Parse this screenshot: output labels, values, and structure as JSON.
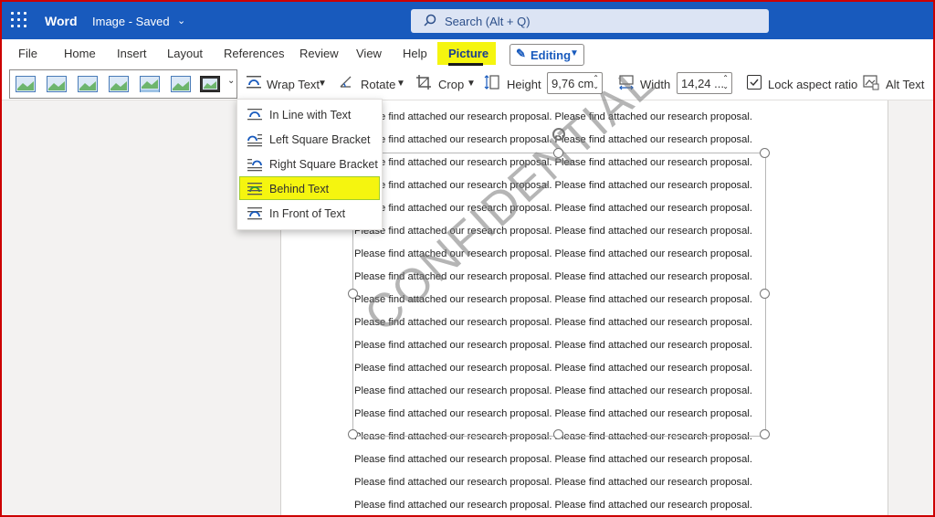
{
  "titlebar": {
    "app_name": "Word",
    "doc_name": "Image - Saved",
    "search_placeholder": "Search (Alt + Q)",
    "background_color": "#185abd"
  },
  "menu": {
    "items": [
      "File",
      "Home",
      "Insert",
      "Layout",
      "References",
      "Review",
      "View",
      "Help",
      "Picture"
    ],
    "active": "Picture",
    "editing_label": "Editing",
    "highlight_color": "#f5f50f"
  },
  "ribbon": {
    "wrap_text": "Wrap Text",
    "rotate": "Rotate",
    "crop": "Crop",
    "height_label": "Height",
    "height_value": "9,76 cm",
    "width_label": "Width",
    "width_value": "14,24 ...",
    "lock_aspect": "Lock aspect ratio",
    "lock_checked": true,
    "alt_text": "Alt Text"
  },
  "wrap_menu": {
    "items": [
      {
        "label": "In Line with Text",
        "icon": "inline-wrap-icon"
      },
      {
        "label": "Left Square Bracket",
        "icon": "left-square-wrap-icon"
      },
      {
        "label": "Right Square Bracket",
        "icon": "right-square-wrap-icon"
      },
      {
        "label": "Behind Text",
        "icon": "behind-text-icon",
        "highlighted": true
      },
      {
        "label": "In Front of Text",
        "icon": "in-front-of-text-icon"
      }
    ]
  },
  "document": {
    "line_text": "Please find attached our research proposal. Please find attached our research proposal.",
    "watermark": "CONFIDENTIAL"
  }
}
